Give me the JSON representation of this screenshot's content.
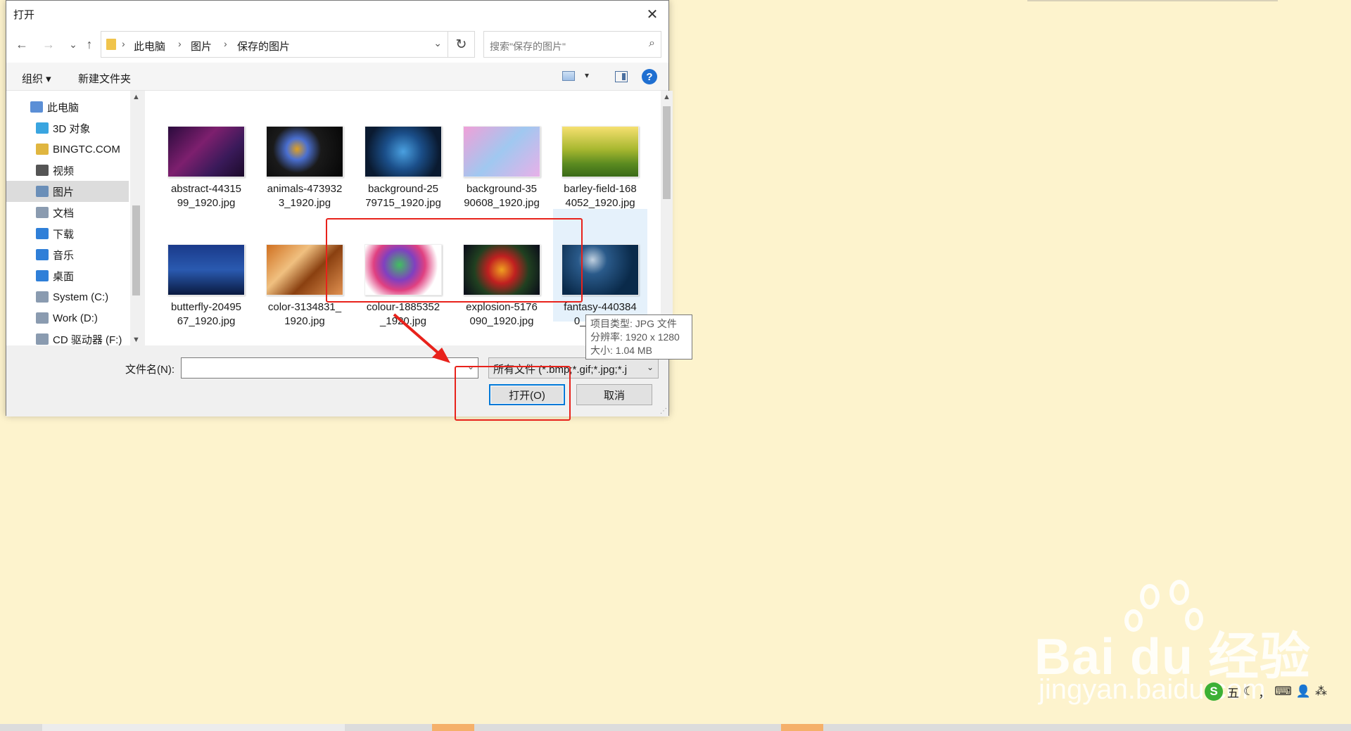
{
  "dialog": {
    "title": "打开",
    "close_glyph": "✕",
    "nav": {
      "back_glyph": "←",
      "forward_glyph": "→",
      "recent_glyph": "⌄",
      "up_glyph": "↑",
      "breadcrumb": [
        "此电脑",
        "图片",
        "保存的图片"
      ],
      "breadcrumb_sep": "›",
      "refresh_glyph": "↻",
      "search_placeholder": "搜索\"保存的图片\"",
      "search_glyph": "⌕"
    },
    "toolbar": {
      "organize_label": "组织 ▾",
      "new_folder_label": "新建文件夹",
      "help_label": "?"
    },
    "tree": [
      {
        "label": "此电脑",
        "icon": "pc-icon",
        "color": "#5b8fd6"
      },
      {
        "label": "3D 对象",
        "icon": "3d-objects-icon",
        "color": "#3aa5e0"
      },
      {
        "label": "BINGTC.COM",
        "icon": "network-folder-icon",
        "color": "#e0b640"
      },
      {
        "label": "视频",
        "icon": "video-icon",
        "color": "#555"
      },
      {
        "label": "图片",
        "icon": "pictures-icon",
        "color": "#6b8fb8"
      },
      {
        "label": "文档",
        "icon": "documents-icon",
        "color": "#8a9bb0"
      },
      {
        "label": "下载",
        "icon": "downloads-icon",
        "color": "#2f7fd8"
      },
      {
        "label": "音乐",
        "icon": "music-icon",
        "color": "#2f7fd8"
      },
      {
        "label": "桌面",
        "icon": "desktop-icon",
        "color": "#2f7fd8"
      },
      {
        "label": "System (C:)",
        "icon": "drive-c-icon",
        "color": "#8a9bb0"
      },
      {
        "label": "Work (D:)",
        "icon": "drive-d-icon",
        "color": "#8a9bb0"
      },
      {
        "label": "CD 驱动器 (F:)",
        "icon": "cd-drive-icon",
        "color": "#8a9bb0"
      }
    ],
    "files": [
      {
        "name": "abstract-4431599_1920.jpg",
        "line1": "abstract-44315",
        "line2": "99_1920.jpg",
        "bg": "linear-gradient(135deg,#2a0b3d,#7d1f6e 40%,#3a1a5a 70%,#1c0a2a)"
      },
      {
        "name": "animals-4739323_1920.jpg",
        "line1": "animals-473932",
        "line2": "3_1920.jpg",
        "bg": "radial-gradient(circle at 40% 45%,#e0a020,#4a6fd0 20%,#1a1a1a 45%,#050505)"
      },
      {
        "name": "background-2579715_1920.jpg",
        "line1": "background-25",
        "line2": "79715_1920.jpg",
        "bg": "radial-gradient(circle at 50% 50%,#4aa0e0,#1b4f8a 40%,#0a1a30 80%)"
      },
      {
        "name": "background-3590608_1920.jpg",
        "line1": "background-35",
        "line2": "90608_1920.jpg",
        "bg": "linear-gradient(135deg,#f0a0d8,#a0c8f0 50%,#e8b0e8)"
      },
      {
        "name": "barley-field-1684052_1920.jpg",
        "line1": "barley-field-168",
        "line2": "4052_1920.jpg",
        "bg": "linear-gradient(#f6e070,#a8b830 45%,#5a8a20 75%,#3a6a18)"
      },
      {
        "name": "butterfly-2049567_1920.jpg",
        "line1": "butterfly-20495",
        "line2": "67_1920.jpg",
        "bg": "linear-gradient(#1a3a8a,#2a5ab0 50%,#0a1a40)"
      },
      {
        "name": "color-3134831_1920.jpg",
        "line1": "color-3134831_",
        "line2": "1920.jpg",
        "bg": "linear-gradient(135deg,#d07020,#f0c080 35%,#8a4010 60%,#e09050)"
      },
      {
        "name": "colour-1885352_1920.jpg",
        "line1": "colour-1885352",
        "line2": "_1920.jpg",
        "bg": "radial-gradient(circle at 45% 40%,#40c060,#8040c0 30%,#e04080 50%,#ffffff 75%)"
      },
      {
        "name": "explosion-5176090_1920.jpg",
        "line1": "explosion-5176",
        "line2": "090_1920.jpg",
        "bg": "radial-gradient(circle at 50% 50%,#f0a020,#c02020 30%,#204020 60%,#0a0a1a)"
      },
      {
        "name": "fantasy-4403840_1920.jpg",
        "line1": "fantasy-440384",
        "line2": "0_1920.jpg",
        "bg": "radial-gradient(circle at 40% 30%,#c0d0e0,#2a5a8a 25%,#0a2a4a 70%)"
      }
    ],
    "bottom": {
      "filename_label": "文件名(N):",
      "filename_value": "",
      "filter_value": "所有文件 (*.bmp;*.gif;*.jpg;*.j",
      "open_label": "打开(O)",
      "cancel_label": "取消"
    },
    "tooltip": {
      "line1": "项目类型: JPG 文件",
      "line2": "分辨率: 1920 x 1280",
      "line3": "大小: 1.04 MB"
    }
  },
  "watermark": {
    "main": "Bai du 经验",
    "sub": "jingyan.baidu.com"
  },
  "ime": {
    "logo": "S",
    "items": [
      "五",
      "☾",
      "，",
      "⌨",
      "👤",
      "⁂"
    ]
  },
  "colors": {
    "annotation_red": "#e8221b",
    "desktop_bg": "#fdf3cd",
    "accent_blue": "#0078d7"
  }
}
